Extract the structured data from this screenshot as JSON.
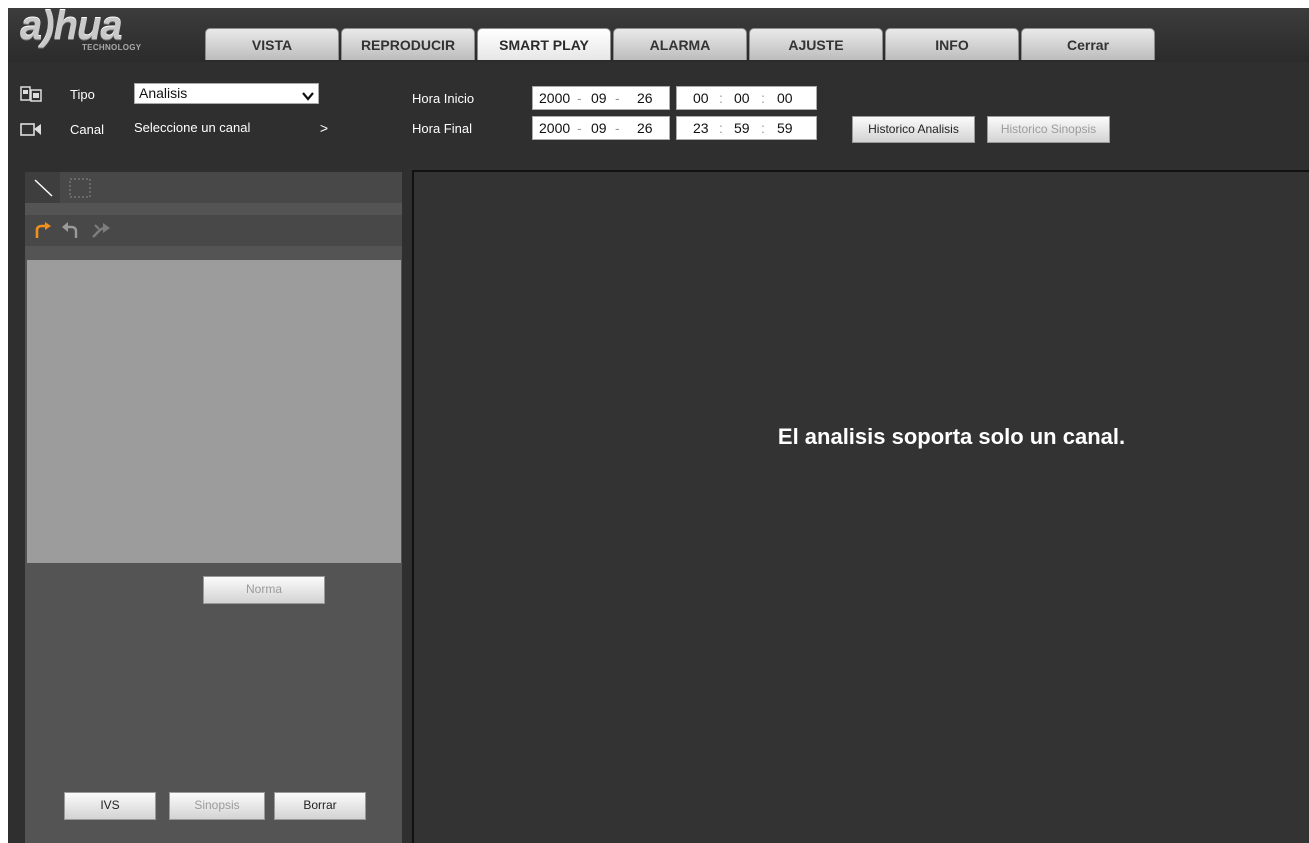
{
  "logo": {
    "wordmark": "a)hua",
    "subtitle": "TECHNOLOGY"
  },
  "tabs": [
    {
      "label": "VISTA"
    },
    {
      "label": "REPRODUCIR"
    },
    {
      "label": "SMART PLAY",
      "active": true
    },
    {
      "label": "ALARMA"
    },
    {
      "label": "AJUSTE"
    },
    {
      "label": "INFO"
    },
    {
      "label": "Cerrar"
    }
  ],
  "controls": {
    "tipo_label": "Tipo",
    "tipo_value": "Analisis",
    "canal_label": "Canal",
    "canal_value": "Seleccione un canal",
    "canal_arrow": ">",
    "hora_inicio_label": "Hora Inicio",
    "hora_final_label": "Hora Final",
    "start": {
      "year": "2000",
      "month": "09",
      "day": "26",
      "hour": "00",
      "minute": "00",
      "second": "00"
    },
    "end": {
      "year": "2000",
      "month": "09",
      "day": "26",
      "hour": "23",
      "minute": "59",
      "second": "59"
    },
    "date_sep": "-",
    "time_sep": ":",
    "historico_analisis": "Historico Analisis",
    "historico_sinopsis": "Historico Sinopsis"
  },
  "left_panel": {
    "norma_button": "Norma",
    "ivs_button": "IVS",
    "sinopsis_button": "Sinopsis",
    "borrar_button": "Borrar"
  },
  "viewer": {
    "message": "El analisis soporta solo un canal."
  },
  "colors": {
    "accent_orange": "#f0901e",
    "background": "#2f2f2f",
    "panel": "#545454",
    "canvas": "#9c9c9c"
  }
}
